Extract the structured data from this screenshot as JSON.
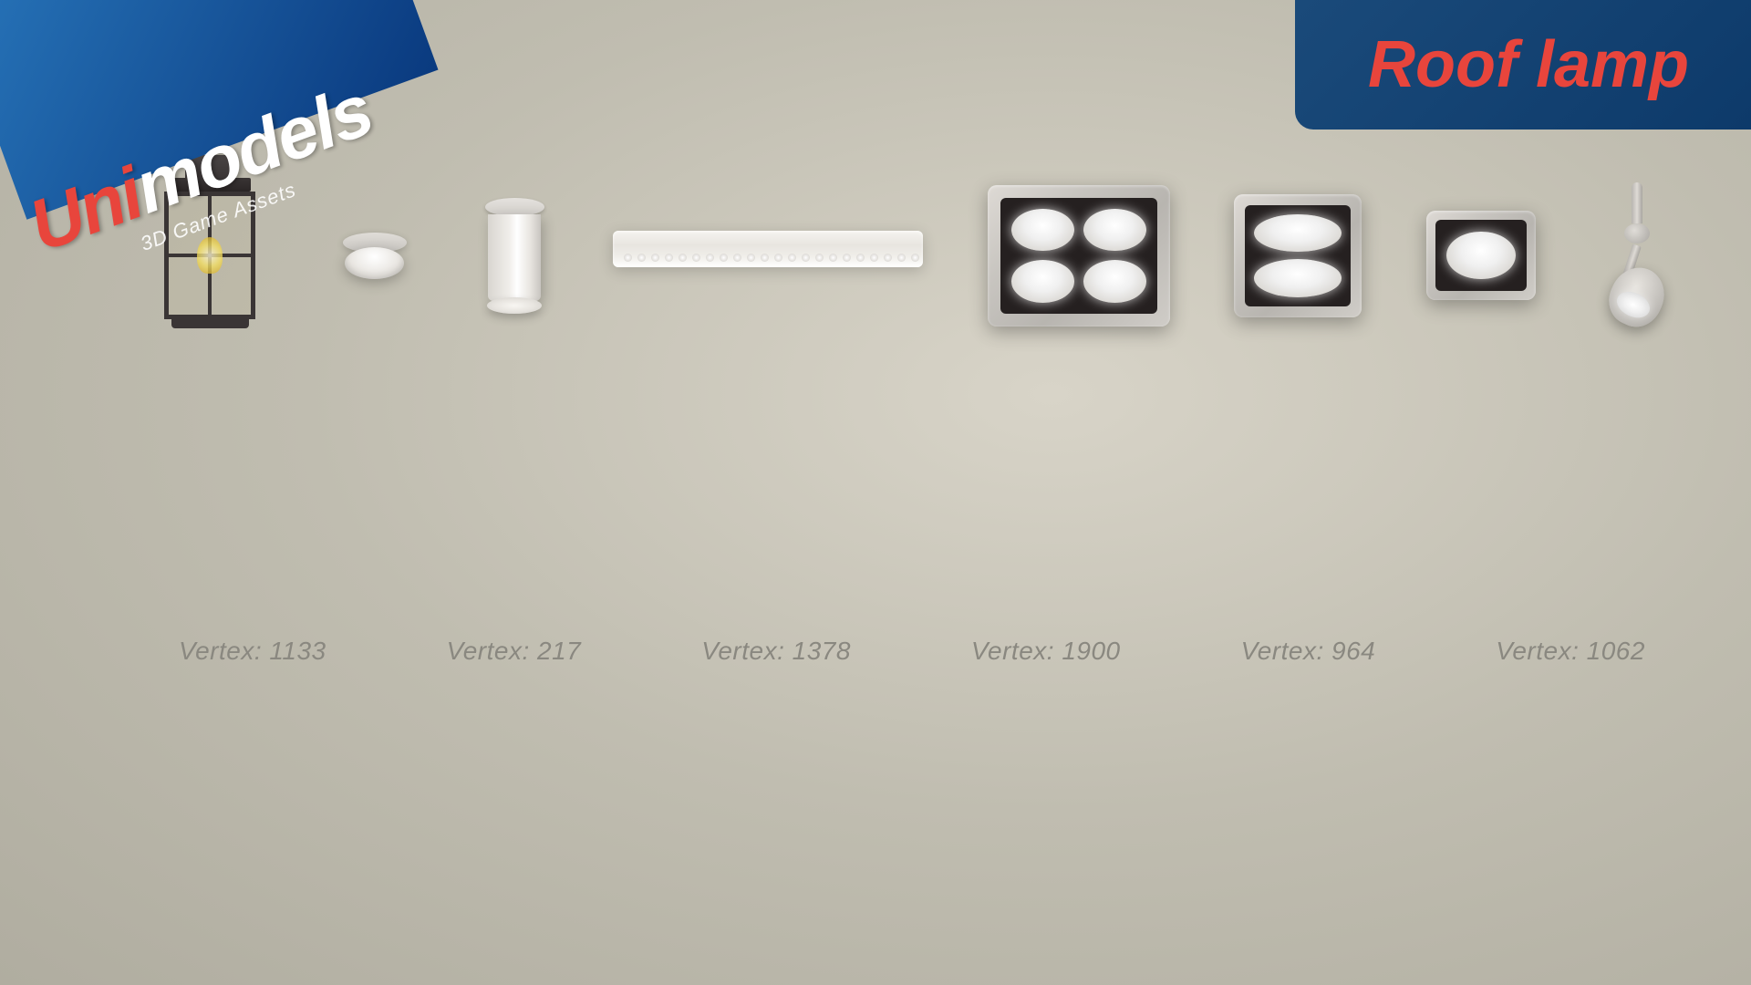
{
  "brand": {
    "name_part1": "Uni",
    "name_part2": "models",
    "subtitle": "3D Game Assets",
    "banner_color": "#1a5a9f"
  },
  "title": {
    "text": "Roof lamp",
    "color": "#e8453c"
  },
  "lamps": [
    {
      "id": "lantern",
      "name": "Lantern ceiling lamp",
      "vertex_label": "Vertex: 1133"
    },
    {
      "id": "round-flush",
      "name": "Round flush mount",
      "vertex_label": "Vertex: 217"
    },
    {
      "id": "cylinder",
      "name": "Cylinder spotlight",
      "vertex_label": ""
    },
    {
      "id": "bar",
      "name": "Linear bar lamp",
      "vertex_label": "Vertex: 1378"
    },
    {
      "id": "panel-4",
      "name": "4-light panel",
      "vertex_label": "Vertex: 1900"
    },
    {
      "id": "panel-2",
      "name": "2-light panel",
      "vertex_label": "Vertex: 964"
    },
    {
      "id": "panel-1",
      "name": "1-light panel",
      "vertex_label": "Vertex: 1062"
    },
    {
      "id": "spot",
      "name": "Spot lamp",
      "vertex_label": ""
    }
  ],
  "vertex_counts": {
    "lamp1": "Vertex: 1133",
    "lamp2": "Vertex: 217",
    "lamp3": "Vertex: 1378",
    "lamp4": "Vertex: 1900",
    "lamp5": "Vertex: 964",
    "lamp6": "Vertex: 1062"
  }
}
